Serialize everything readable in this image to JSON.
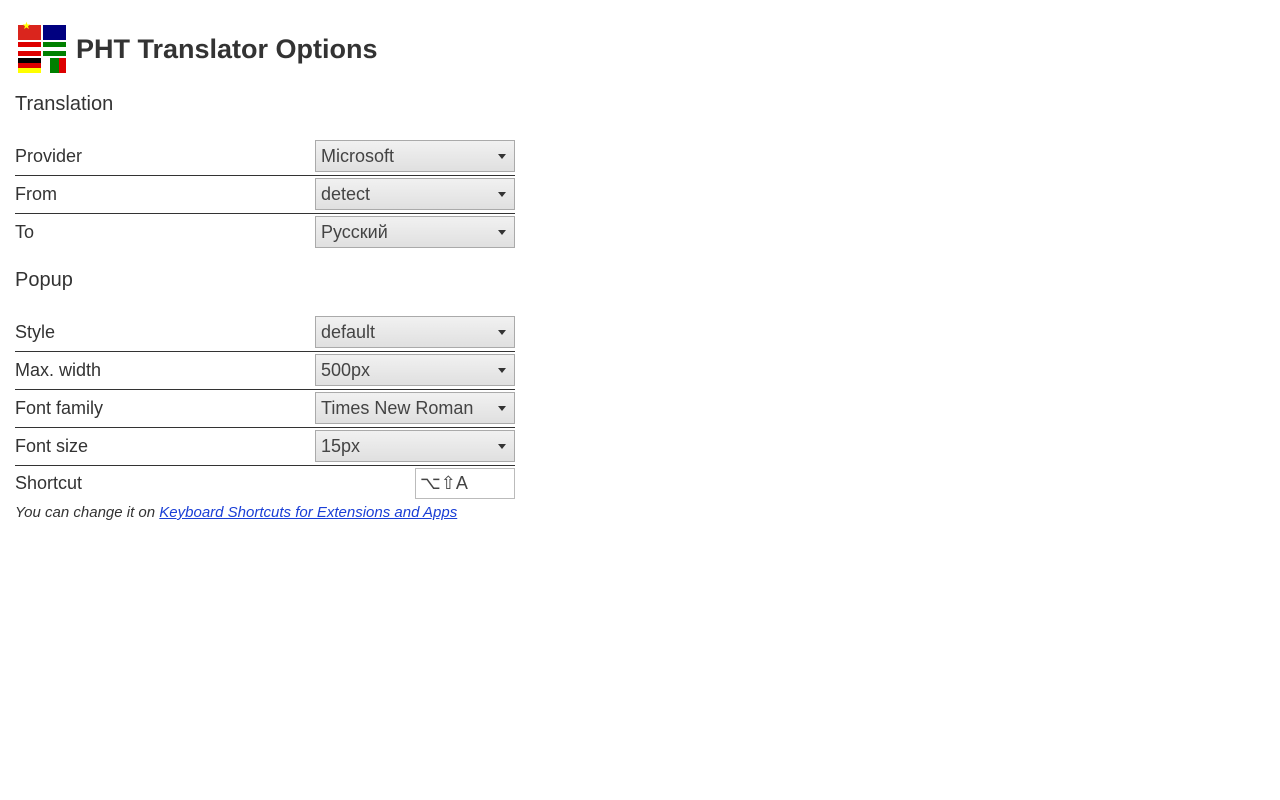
{
  "header": {
    "title": "PHT Translator Options"
  },
  "sections": {
    "translation": {
      "title": "Translation",
      "provider": {
        "label": "Provider",
        "value": "Microsoft"
      },
      "from": {
        "label": "From",
        "value": "detect"
      },
      "to": {
        "label": "To",
        "value": "Русский"
      }
    },
    "popup": {
      "title": "Popup",
      "style": {
        "label": "Style",
        "value": "default"
      },
      "maxwidth": {
        "label": "Max. width",
        "value": "500px"
      },
      "fontfamily": {
        "label": "Font family",
        "value": "Times New Roman"
      },
      "fontsize": {
        "label": "Font size",
        "value": "15px"
      },
      "shortcut": {
        "label": "Shortcut",
        "value": "⌥⇧A"
      },
      "hint_prefix": "You can change it on ",
      "hint_link": "Keyboard Shortcuts for Extensions and Apps"
    }
  }
}
